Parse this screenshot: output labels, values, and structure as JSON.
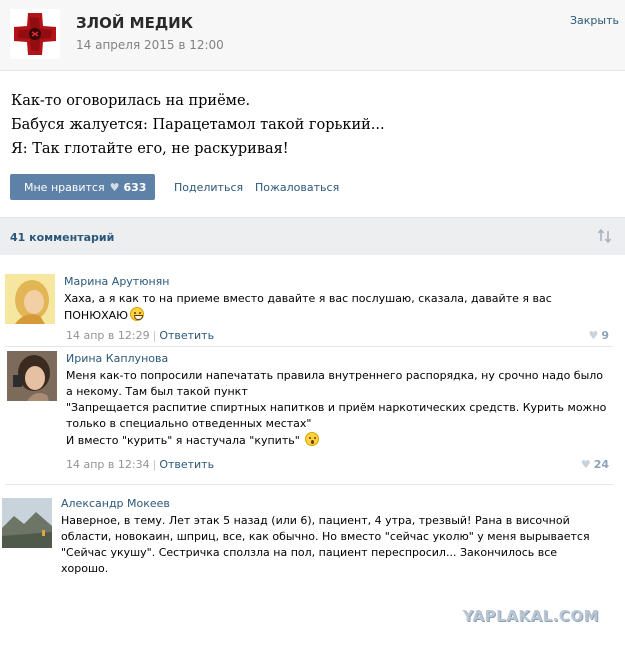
{
  "post": {
    "group_name": "ЗЛОЙ МЕДИК",
    "date": "14 апреля 2015 в 12:00",
    "close_label": "Закрыть",
    "text_lines": [
      "Как-то оговорилась на приёме.",
      "Бабуся жалуется: Парацетамол такой горький...",
      "Я: Так глотайте его, не раскуривая!"
    ],
    "like_label": "Мне нравится",
    "like_count": "633",
    "share_label": "Поделиться",
    "report_label": "Пожаловаться",
    "accent_color": "#5e81a8",
    "link_color": "#2b587a"
  },
  "comments_bar": {
    "count_label": "41 комментарий",
    "sort_icon": "sort-arrows-icon"
  },
  "comments": [
    {
      "author": "Марина Арутюнян",
      "text_lines": [
        "Хаха, а я как то на приеме вместо давайте я вас послушаю, сказала, давайте я вас",
        "ПОНЮХАЮ"
      ],
      "emoji": "grinning-emoji",
      "date": "14 апр в 12:29",
      "reply_label": "Ответить",
      "likes": "9"
    },
    {
      "author": "Ирина Каплунова",
      "text_lines": [
        "Меня как-то попросили напечатать правила внутреннего распорядка, ну срочно надо было",
        "а некому. Там был такой пункт",
        "\"Запрещается распитие спиртных напитков и приём наркотических средств. Курить можно",
        "только в специально отведенных местах\"",
        "И вместо \"курить\" я настучала \"купить\""
      ],
      "emoji": "surprised-emoji",
      "date": "14 апр в 12:34",
      "reply_label": "Ответить",
      "likes": "24"
    },
    {
      "author": "Александр Мокеев",
      "text_lines": [
        "Наверное, в тему. Лет этак 5 назад (или 6), пациент, 4 утра, трезвый! Рана в височной",
        "области, новокаин, шприц, все, как обычно. Но вместо \"сейчас уколю\" у меня вырывается",
        "\"Сейчас укушу\". Сестричка сползла на пол, пациент переспросил... Закончилось все",
        "хорошо."
      ]
    }
  ],
  "watermark": "YAPLAKAL.COM"
}
